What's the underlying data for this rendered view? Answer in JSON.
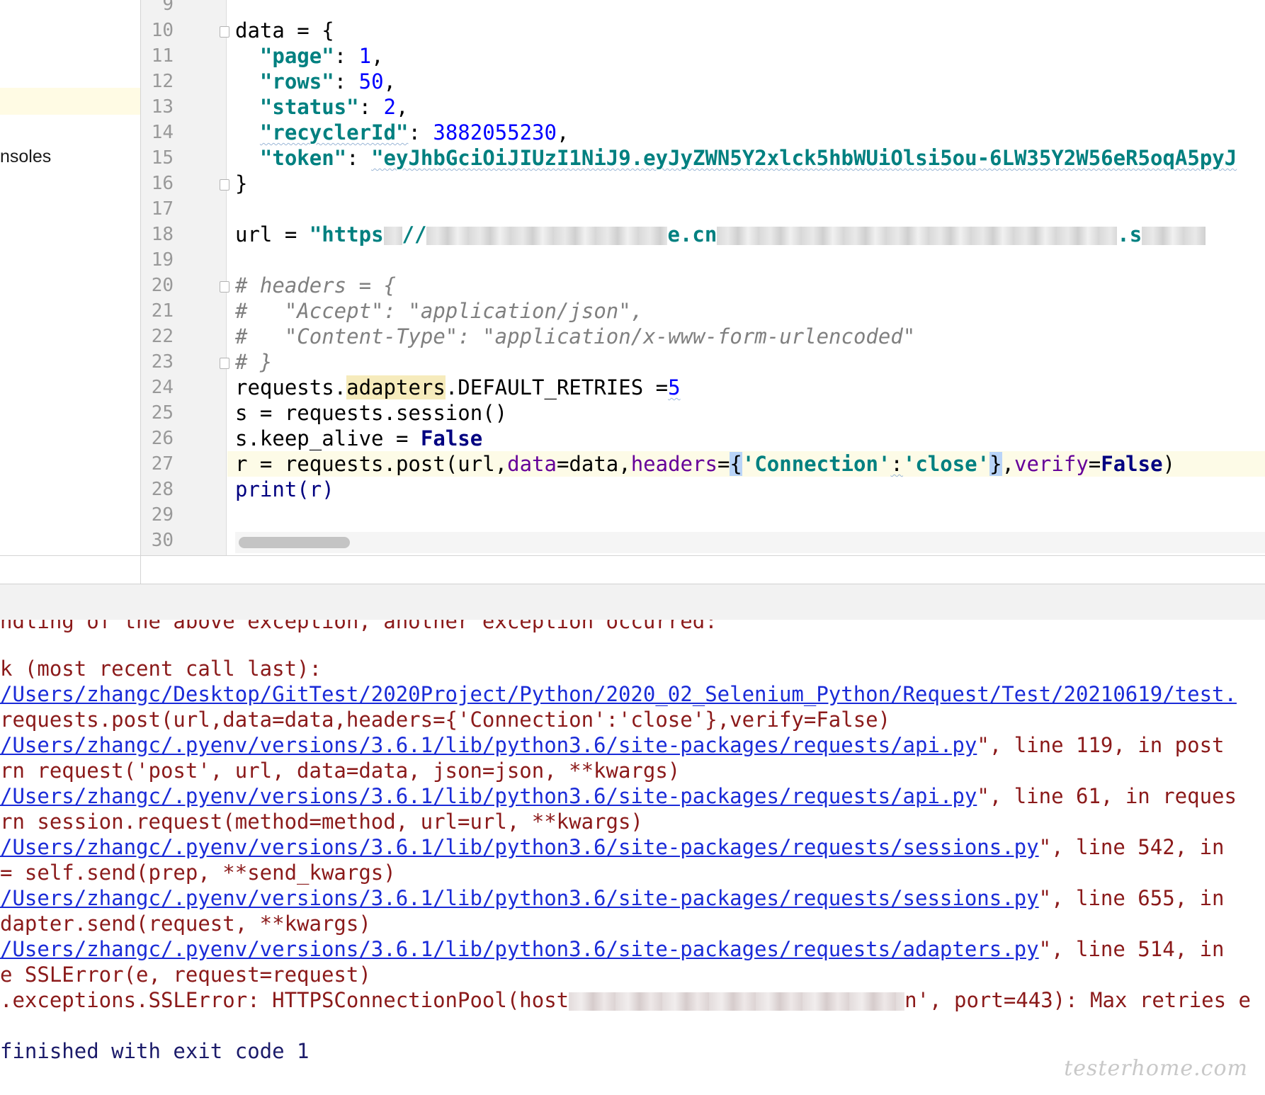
{
  "sidebar": {
    "node_label": "nsoles"
  },
  "editor": {
    "line_numbers": [
      "9",
      "10",
      "11",
      "12",
      "13",
      "14",
      "15",
      "16",
      "17",
      "18",
      "19",
      "20",
      "21",
      "22",
      "23",
      "24",
      "25",
      "26",
      "27",
      "28",
      "29",
      "30"
    ],
    "code": {
      "l10": "data = {",
      "l11_key": "\"page\"",
      "l11_val": "1",
      "l12_key": "\"rows\"",
      "l12_val": "50",
      "l13_key": "\"status\"",
      "l13_val": "2",
      "l14_key": "\"recyclerId\"",
      "l14_val": "3882055230",
      "l15_key": "\"token\"",
      "l15_val": "\"eyJhbGciOiJIUzI1NiJ9.eyJyZWN5Y2xlck5hbWUiOlsi5ou-6LW35Y2W56eR5oqA5pyJ",
      "l16": "}",
      "l18_prefix": "url = ",
      "l18_a": "\"https",
      "l18_b": "//",
      "l18_c": "e.cn",
      "l18_d": ".s",
      "l20": "# headers = {",
      "l21": "#   \"Accept\": \"application/json\",",
      "l22": "#   \"Content-Type\": \"application/x-www-form-urlencoded\"",
      "l23": "# }",
      "l24_a": "requests.",
      "l24_b": "adapters",
      "l24_c": ".DEFAULT_RETRIES =",
      "l24_d": "5",
      "l25": "s = requests.session()",
      "l26_a": "s.keep_alive = ",
      "l26_b": "False",
      "l27_a": "r = requests.post(url,",
      "l27_b": "data",
      "l27_c": "=data,",
      "l27_d": "headers",
      "l27_e": "=",
      "l27_f": "{",
      "l27_g": "'Connection'",
      "l27_h": ":",
      "l27_i": "'close'",
      "l27_j": "}",
      "l27_k": ",",
      "l27_l": "verify",
      "l27_m": "=",
      "l27_n": "False",
      "l27_o": ")",
      "l28": "print(r)"
    }
  },
  "console": {
    "clipped_line": "ndling of the above exception, another exception occurred:",
    "traceback_head": "k (most recent call last):",
    "path_test": "/Users/zhangc/Desktop/GitTest/2020Project/Python/2020_02_Selenium_Python/Request/Test/20210619/test.",
    "src_post": "requests.post(url,data=data,headers={'Connection':'close'},verify=False)",
    "path_api": "/Users/zhangc/.pyenv/versions/3.6.1/lib/python3.6/site-packages/requests/api.py",
    "tail_api1": "\", line 119, in post",
    "src_api1": "rn request('post', url, data=data, json=json, **kwargs)",
    "tail_api2": "\", line 61, in reques",
    "src_api2": "rn session.request(method=method, url=url, **kwargs)",
    "path_sessions": "/Users/zhangc/.pyenv/versions/3.6.1/lib/python3.6/site-packages/requests/sessions.py",
    "tail_sess1": "\", line 542, in",
    "src_sess1": "= self.send(prep, **send_kwargs)",
    "tail_sess2": "\", line 655, in",
    "src_sess2": "dapter.send(request, **kwargs)",
    "path_adapters": "/Users/zhangc/.pyenv/versions/3.6.1/lib/python3.6/site-packages/requests/adapters.py",
    "tail_adapt": "\", line 514, in",
    "src_adapt": "e SSLError(e, request=request)",
    "err_a": ".exceptions.SSLError: HTTPSConnectionPool(host",
    "err_b": "n', port=443): Max retries e",
    "finished": "finished with exit code 1"
  },
  "watermark": "testerhome.com"
}
